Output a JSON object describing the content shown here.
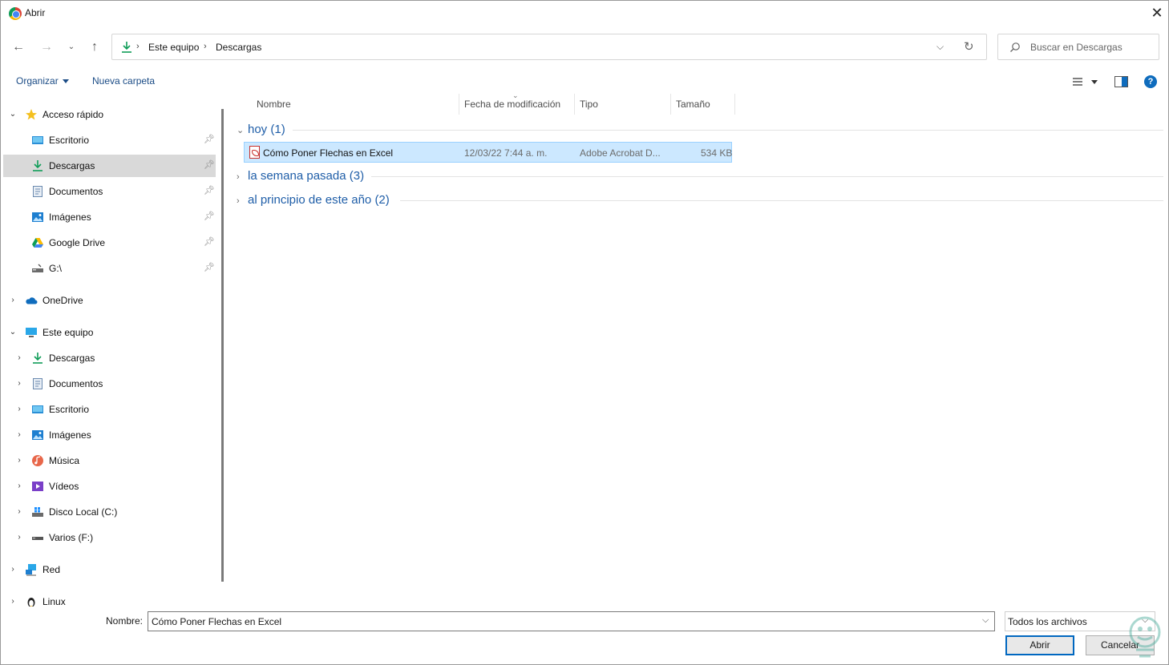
{
  "window": {
    "title": "Abrir"
  },
  "address": {
    "crumbs": [
      "Este equipo",
      "Descargas"
    ],
    "search_placeholder": "Buscar en Descargas"
  },
  "commands": {
    "organize": "Organizar",
    "new_folder": "Nueva carpeta",
    "help": "?"
  },
  "nav": {
    "quick_access": "Acceso rápido",
    "quick_items": [
      "Escritorio",
      "Descargas",
      "Documentos",
      "Imágenes",
      "Google Drive",
      "G:\\"
    ],
    "onedrive": "OneDrive",
    "this_pc": "Este equipo",
    "pc_items": [
      "Descargas",
      "Documentos",
      "Escritorio",
      "Imágenes",
      "Música",
      "Vídeos",
      "Disco Local (C:)",
      "Varios (F:)"
    ],
    "network": "Red",
    "linux": "Linux"
  },
  "columns": {
    "name": "Nombre",
    "date": "Fecha de modificación",
    "type": "Tipo",
    "size": "Tamaño"
  },
  "groups": [
    {
      "label": "hoy (1)",
      "expanded": true
    },
    {
      "label": "la semana pasada (3)",
      "expanded": false
    },
    {
      "label": "al principio de este año (2)",
      "expanded": false
    }
  ],
  "file": {
    "name": "Cómo Poner Flechas en Excel",
    "date": "12/03/22 7:44 a. m.",
    "type": "Adobe Acrobat D...",
    "size": "534 KB"
  },
  "bottom": {
    "name_label": "Nombre:",
    "name_value": "Cómo Poner Flechas en Excel",
    "filter": "Todos los archivos",
    "open": "Abrir",
    "cancel": "Cancelar"
  }
}
